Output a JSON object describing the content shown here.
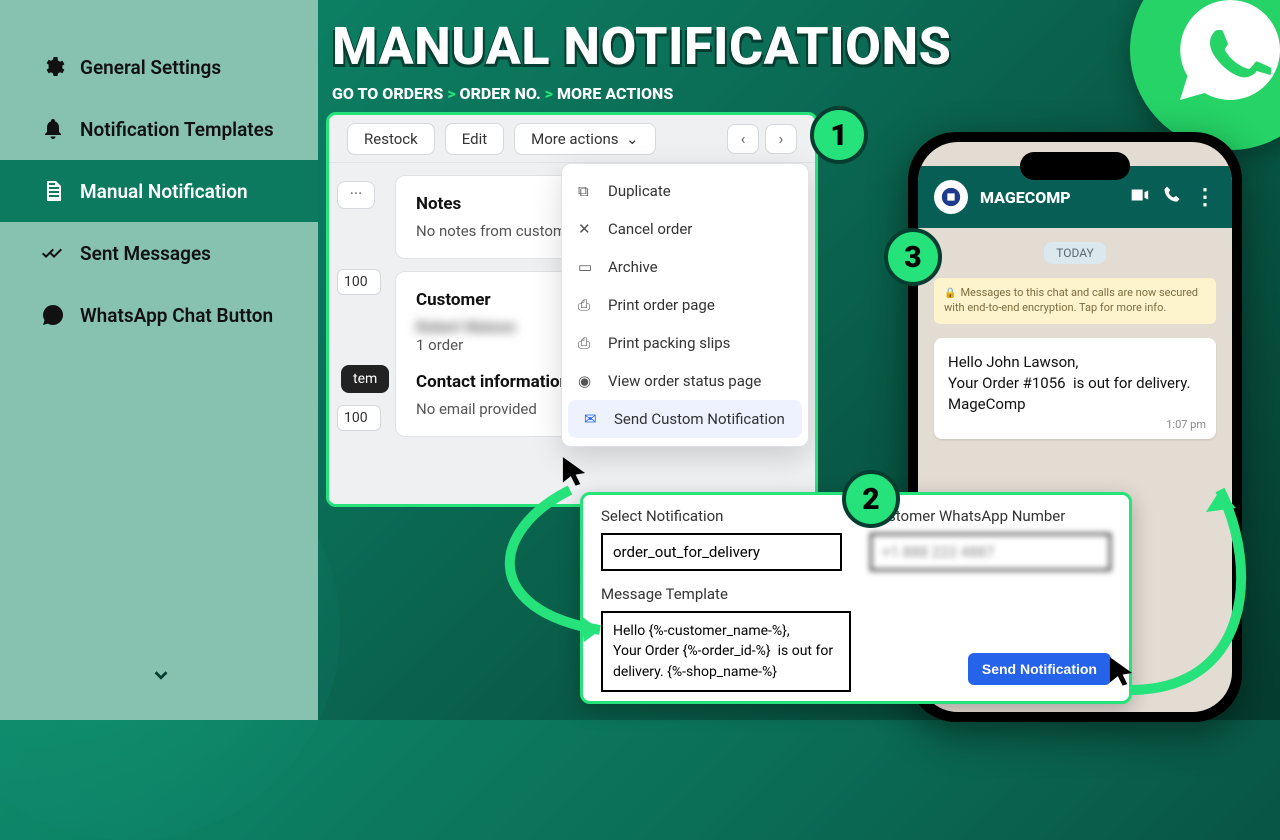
{
  "hero": "MANUAL NOTIFICATIONS",
  "breadcrumb": {
    "a": "GO TO ORDERS",
    "b": "ORDER NO.",
    "c": "MORE ACTIONS"
  },
  "sidebar": {
    "items": [
      {
        "label": "General Settings"
      },
      {
        "label": "Notification Templates"
      },
      {
        "label": "Manual Notification"
      },
      {
        "label": "Sent Messages"
      },
      {
        "label": "WhatsApp Chat Button"
      }
    ]
  },
  "steps": {
    "s1": "1",
    "s2": "2",
    "s3": "3"
  },
  "panel1": {
    "buttons": {
      "restock": "Restock",
      "edit": "Edit",
      "more": "More actions"
    },
    "badge100": "100",
    "notes_h": "Notes",
    "notes_p": "No notes from customer",
    "customer_h": "Customer",
    "customer_blur": "Robert Watson",
    "customer_ct": "1 order",
    "contact_h": "Contact information",
    "contact_p": "No email provided",
    "item_chip": "tem",
    "dropdown": [
      {
        "icon": "duplicate",
        "label": "Duplicate"
      },
      {
        "icon": "cancel",
        "label": "Cancel order"
      },
      {
        "icon": "archive",
        "label": "Archive"
      },
      {
        "icon": "print",
        "label": "Print order page"
      },
      {
        "icon": "print",
        "label": "Print packing slips"
      },
      {
        "icon": "eye",
        "label": "View order status page"
      },
      {
        "icon": "bell",
        "label": "Send Custom Notification"
      }
    ]
  },
  "panel2": {
    "sel_label": "Select Notification",
    "sel_value": "order_out_for_delivery",
    "num_label": "Customer WhatsApp Number",
    "num_value": "+1 888 222 4887",
    "tpl_label": "Message Template",
    "tpl_value": "Hello {%-customer_name-%},\nYour Order {%-order_id-%}  is out for delivery. {%-shop_name-%}",
    "send_btn": "Send Notification"
  },
  "phone": {
    "contact": "MAGECOMP",
    "today": "TODAY",
    "encryption": "Messages to this chat and calls are now secured with end-to-end encryption. Tap for more info.",
    "message": "Hello John Lawson,\nYour Order #1056  is out for delivery. MageComp",
    "time": "1:07 pm"
  }
}
